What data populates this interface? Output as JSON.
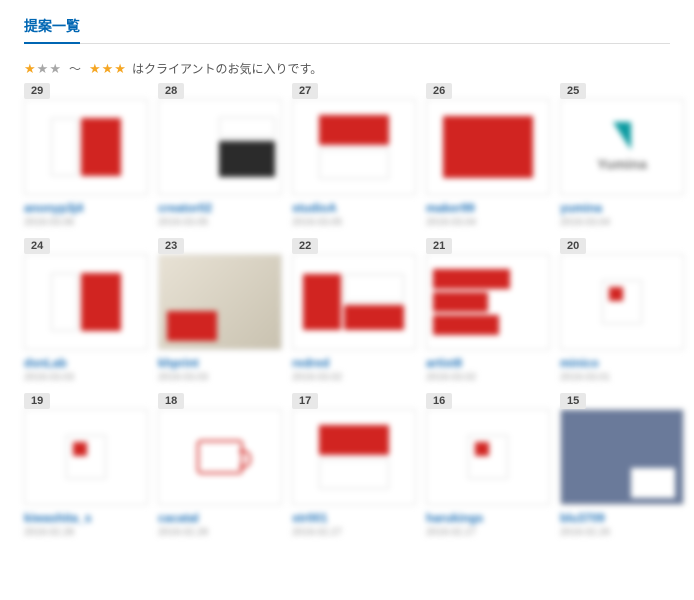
{
  "section_title": "提案一覧",
  "legend_text": "はクライアントのお気に入りです。",
  "legend_tilde": "～",
  "cards": [
    {
      "num": "29",
      "author": "anonyp3j4",
      "date": "2019.03.06",
      "variant": "v-red-pair"
    },
    {
      "num": "28",
      "author": "creator02",
      "date": "2019.03.05",
      "variant": "v-side-dark"
    },
    {
      "num": "27",
      "author": "studioA",
      "date": "2019.03.05",
      "variant": "v-two-cards"
    },
    {
      "num": "26",
      "author": "maker99",
      "date": "2019.03.04",
      "variant": "v-big-red"
    },
    {
      "num": "25",
      "author": "yumina",
      "date": "2019.03.04",
      "variant": "v-logo"
    },
    {
      "num": "24",
      "author": "dsnLab",
      "date": "2019.03.03",
      "variant": "v-red-pair"
    },
    {
      "num": "23",
      "author": "khprint",
      "date": "2019.03.03",
      "variant": "v-photo"
    },
    {
      "num": "22",
      "author": "redred",
      "date": "2019.03.02",
      "variant": "v-split"
    },
    {
      "num": "21",
      "author": "artist8",
      "date": "2019.03.02",
      "variant": "v-stack3"
    },
    {
      "num": "20",
      "author": "minico",
      "date": "2019.03.01",
      "variant": "v-mini"
    },
    {
      "num": "19",
      "author": "kiwashita_s",
      "date": "2019.02.28",
      "variant": "v-mini"
    },
    {
      "num": "18",
      "author": "cacatal",
      "date": "2019.02.28",
      "variant": "v-mug"
    },
    {
      "num": "17",
      "author": "str001",
      "date": "2019.02.27",
      "variant": "v-two-cards"
    },
    {
      "num": "16",
      "author": "harukings",
      "date": "2019.02.27",
      "variant": "v-mini"
    },
    {
      "num": "15",
      "author": "blu3709",
      "date": "2019.02.26",
      "variant": "v-blue"
    }
  ]
}
